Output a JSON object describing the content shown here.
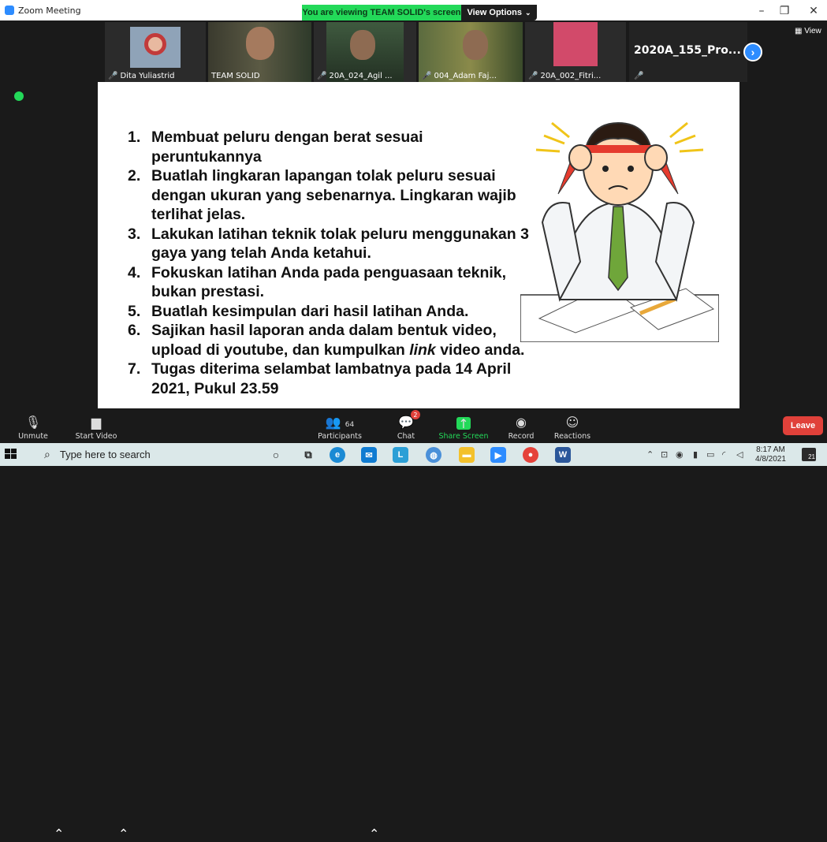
{
  "window": {
    "title": "Zoom Meeting"
  },
  "share_banner": {
    "viewing": "You are viewing TEAM SOLID's screen",
    "view_options": "View Options"
  },
  "window_controls": {
    "minimize": "–",
    "restore": "❐",
    "close": "✕"
  },
  "participants": [
    {
      "name": "Dita Yuliastrid",
      "muted": true,
      "bg": "#6f8aa8"
    },
    {
      "name": "TEAM SOLID",
      "muted": false,
      "bg": "#4a4a3a"
    },
    {
      "name": "20A_024_Agil ...",
      "muted": true,
      "bg": "#3f5a3f"
    },
    {
      "name": "004_Adam Faj...",
      "muted": true,
      "bg": "#5b6b3f"
    },
    {
      "name": "20A_002_Fitri...",
      "muted": true,
      "bg": "#d24a6a"
    }
  ],
  "big_tile": {
    "name": "2020A_155_Pro..."
  },
  "view_button": "View",
  "slide": {
    "items": [
      {
        "num": "1.",
        "lines": [
          "Membuat peluru dengan berat sesuai",
          "peruntukannya"
        ]
      },
      {
        "num": "2.",
        "lines": [
          "Buatlah lingkaran lapangan tolak peluru sesuai",
          "dengan ukuran yang sebenarnya. Lingkaran wajib",
          "terlihat jelas."
        ]
      },
      {
        "num": "3.",
        "lines": [
          "Lakukan latihan teknik tolak peluru menggunakan 3",
          "gaya yang telah Anda ketahui."
        ]
      },
      {
        "num": "4.",
        "lines": [
          "Fokuskan latihan Anda pada penguasaan teknik,",
          "bukan prestasi."
        ]
      },
      {
        "num": "5.",
        "lines": [
          "Buatlah kesimpulan dari hasil latihan Anda."
        ]
      },
      {
        "num": "6.",
        "lines": [
          "Sajikan hasil laporan anda dalam bentuk video,",
          "upload  di youtube, dan kumpulkan link video anda."
        ]
      },
      {
        "num": "7.",
        "lines": [
          "Tugas diterima selambat lambatnya pada 14 April",
          "2021, Pukul 23.59"
        ]
      }
    ]
  },
  "toolbar": {
    "unmute": "Unmute",
    "start_video": "Start Video",
    "participants": "Participants",
    "participants_count": "64",
    "chat": "Chat",
    "chat_badge": "2",
    "share_screen": "Share Screen",
    "record": "Record",
    "reactions": "Reactions",
    "leave": "Leave"
  },
  "taskbar": {
    "search_placeholder": "Type here to search",
    "time": "8:17 AM",
    "date": "4/8/2021",
    "notifications": "21"
  },
  "colors": {
    "zoom_blue": "#2d8cff",
    "share_green": "#23d959",
    "leave_red": "#e0413a"
  }
}
